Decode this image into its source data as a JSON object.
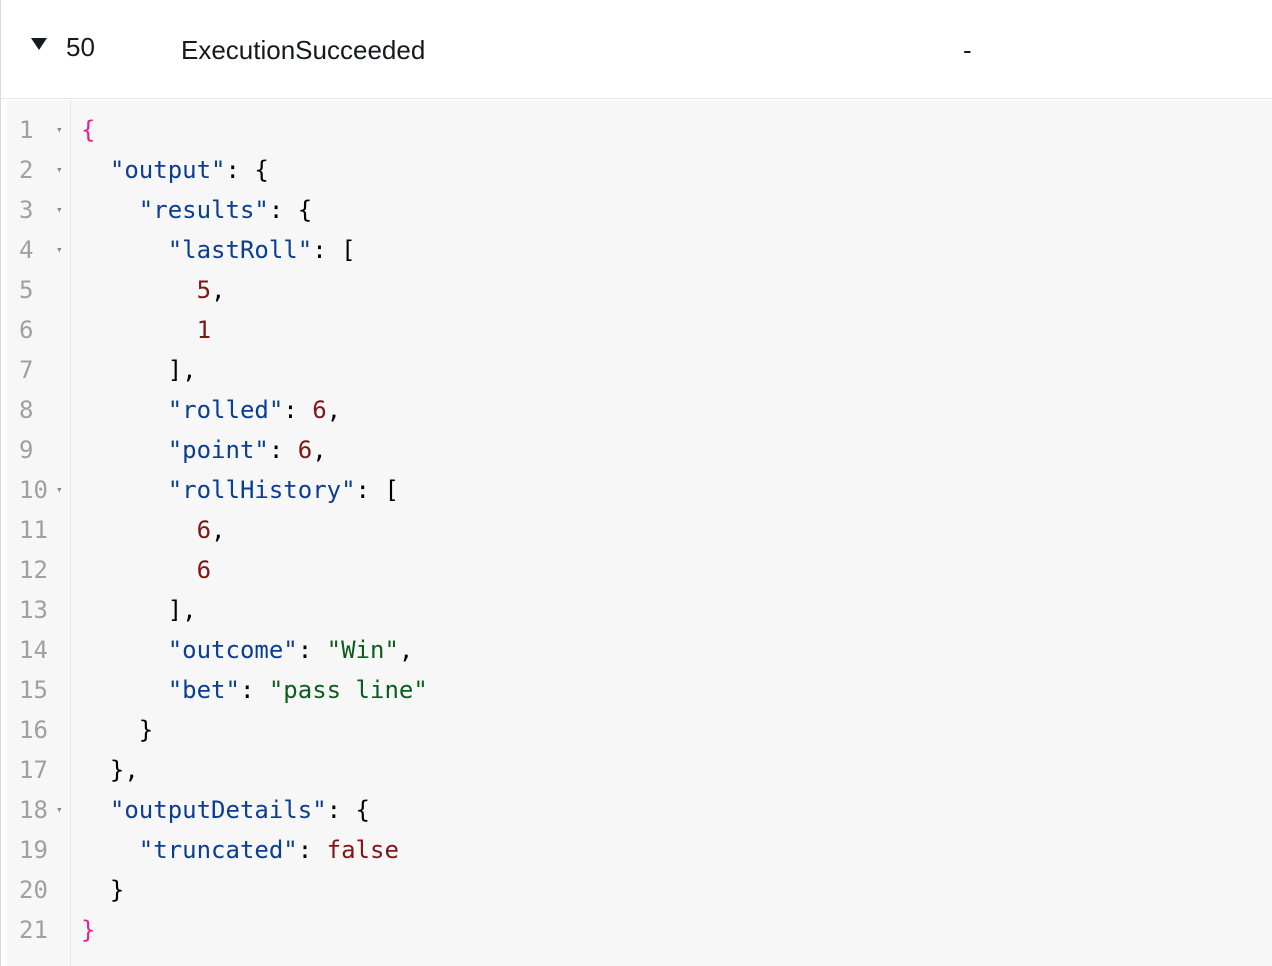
{
  "event": {
    "id": "50",
    "type": "ExecutionSucceeded",
    "resource": "-"
  },
  "code_lines": [
    {
      "n": "1",
      "fold": true,
      "tokens": [
        {
          "t": "{",
          "c": "root"
        }
      ]
    },
    {
      "n": "2",
      "fold": true,
      "tokens": [
        {
          "t": "  "
        },
        {
          "t": "\"output\"",
          "c": "key"
        },
        {
          "t": ": {",
          "c": "punct"
        }
      ]
    },
    {
      "n": "3",
      "fold": true,
      "tokens": [
        {
          "t": "    "
        },
        {
          "t": "\"results\"",
          "c": "key"
        },
        {
          "t": ": {",
          "c": "punct"
        }
      ]
    },
    {
      "n": "4",
      "fold": true,
      "tokens": [
        {
          "t": "      "
        },
        {
          "t": "\"lastRoll\"",
          "c": "key"
        },
        {
          "t": ": [",
          "c": "punct"
        }
      ]
    },
    {
      "n": "5",
      "fold": false,
      "tokens": [
        {
          "t": "        "
        },
        {
          "t": "5",
          "c": "number"
        },
        {
          "t": ",",
          "c": "punct"
        }
      ]
    },
    {
      "n": "6",
      "fold": false,
      "tokens": [
        {
          "t": "        "
        },
        {
          "t": "1",
          "c": "number"
        }
      ]
    },
    {
      "n": "7",
      "fold": false,
      "tokens": [
        {
          "t": "      "
        },
        {
          "t": "],",
          "c": "punct"
        }
      ]
    },
    {
      "n": "8",
      "fold": false,
      "tokens": [
        {
          "t": "      "
        },
        {
          "t": "\"rolled\"",
          "c": "key"
        },
        {
          "t": ": ",
          "c": "punct"
        },
        {
          "t": "6",
          "c": "number"
        },
        {
          "t": ",",
          "c": "punct"
        }
      ]
    },
    {
      "n": "9",
      "fold": false,
      "tokens": [
        {
          "t": "      "
        },
        {
          "t": "\"point\"",
          "c": "key"
        },
        {
          "t": ": ",
          "c": "punct"
        },
        {
          "t": "6",
          "c": "number"
        },
        {
          "t": ",",
          "c": "punct"
        }
      ]
    },
    {
      "n": "10",
      "fold": true,
      "tokens": [
        {
          "t": "      "
        },
        {
          "t": "\"rollHistory\"",
          "c": "key"
        },
        {
          "t": ": [",
          "c": "punct"
        }
      ]
    },
    {
      "n": "11",
      "fold": false,
      "tokens": [
        {
          "t": "        "
        },
        {
          "t": "6",
          "c": "number"
        },
        {
          "t": ",",
          "c": "punct"
        }
      ]
    },
    {
      "n": "12",
      "fold": false,
      "tokens": [
        {
          "t": "        "
        },
        {
          "t": "6",
          "c": "number"
        }
      ]
    },
    {
      "n": "13",
      "fold": false,
      "tokens": [
        {
          "t": "      "
        },
        {
          "t": "],",
          "c": "punct"
        }
      ]
    },
    {
      "n": "14",
      "fold": false,
      "tokens": [
        {
          "t": "      "
        },
        {
          "t": "\"outcome\"",
          "c": "key"
        },
        {
          "t": ": ",
          "c": "punct"
        },
        {
          "t": "\"Win\"",
          "c": "string"
        },
        {
          "t": ",",
          "c": "punct"
        }
      ]
    },
    {
      "n": "15",
      "fold": false,
      "tokens": [
        {
          "t": "      "
        },
        {
          "t": "\"bet\"",
          "c": "key"
        },
        {
          "t": ": ",
          "c": "punct"
        },
        {
          "t": "\"pass line\"",
          "c": "string"
        }
      ]
    },
    {
      "n": "16",
      "fold": false,
      "tokens": [
        {
          "t": "    "
        },
        {
          "t": "}",
          "c": "punct"
        }
      ]
    },
    {
      "n": "17",
      "fold": false,
      "tokens": [
        {
          "t": "  "
        },
        {
          "t": "},",
          "c": "punct"
        }
      ]
    },
    {
      "n": "18",
      "fold": true,
      "tokens": [
        {
          "t": "  "
        },
        {
          "t": "\"outputDetails\"",
          "c": "key"
        },
        {
          "t": ": {",
          "c": "punct"
        }
      ]
    },
    {
      "n": "19",
      "fold": false,
      "tokens": [
        {
          "t": "    "
        },
        {
          "t": "\"truncated\"",
          "c": "key"
        },
        {
          "t": ": ",
          "c": "punct"
        },
        {
          "t": "false",
          "c": "bool"
        }
      ]
    },
    {
      "n": "20",
      "fold": false,
      "tokens": [
        {
          "t": "  "
        },
        {
          "t": "}",
          "c": "punct"
        }
      ]
    },
    {
      "n": "21",
      "fold": false,
      "tokens": [
        {
          "t": "}",
          "c": "root"
        }
      ]
    }
  ],
  "icons": {
    "expand_toggle": "triangle-down-icon",
    "fold_arrow": "▾"
  },
  "colors": {
    "key": "#0b3d91",
    "string": "#0b5d1e",
    "number": "#7f1616",
    "root_brace": "#ee1e8c",
    "line_number": "#a0a0a0",
    "code_background": "#f7f7f7"
  }
}
